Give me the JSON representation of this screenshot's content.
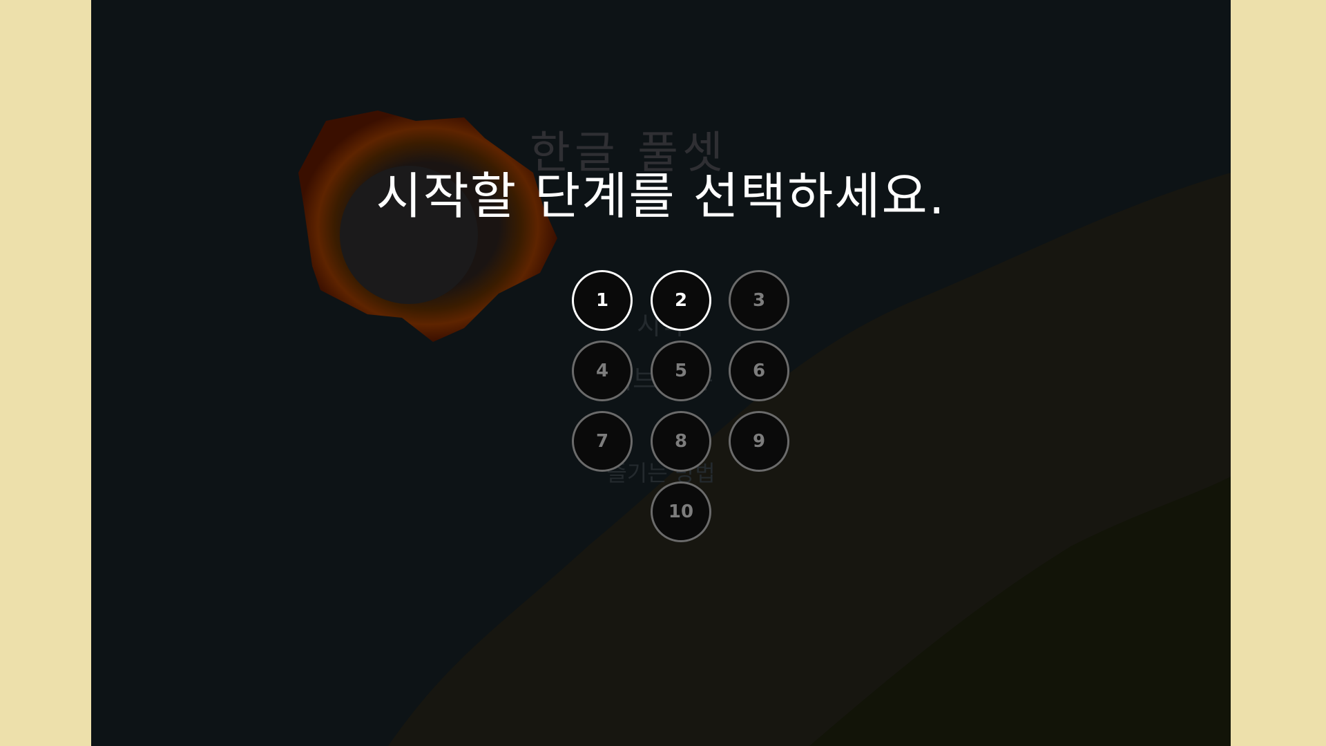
{
  "background_menu": {
    "title": "한글 풀셋",
    "items": [
      "시작",
      "서브 메뉴",
      "즐기는 방법"
    ]
  },
  "overlay": {
    "prompt": "시작할 단계를 선택하세요."
  },
  "levels": [
    {
      "label": "1",
      "unlocked": true
    },
    {
      "label": "2",
      "unlocked": true
    },
    {
      "label": "3",
      "unlocked": false
    },
    {
      "label": "4",
      "unlocked": false
    },
    {
      "label": "5",
      "unlocked": false
    },
    {
      "label": "6",
      "unlocked": false
    },
    {
      "label": "7",
      "unlocked": false
    },
    {
      "label": "8",
      "unlocked": false
    },
    {
      "label": "9",
      "unlocked": false
    },
    {
      "label": "10",
      "unlocked": false
    }
  ],
  "colors": {
    "page_background": "#ede0ab",
    "stage_background": "#0d1316",
    "hill_near": "#171610",
    "hill_far": "#121408",
    "sun_glow": "#8a2a00",
    "unlocked_level": "#ffffff",
    "locked_level": "#7d7d7d"
  }
}
